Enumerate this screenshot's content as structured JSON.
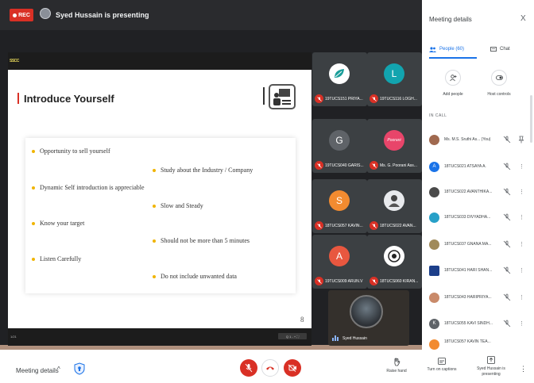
{
  "top_bar": {
    "rec_label": "REC",
    "presenting_text": "Syed Hussain is presenting"
  },
  "shared_screen": {
    "top_mark": "SSCC",
    "slide_title": "Introduce Yourself",
    "bullets": [
      "Opportunity to sell yourself",
      "Study about the Industry / Company",
      "Dynamic Self introduction is appreciable",
      "Slow and Steady",
      "Know your target",
      "Should not be more than 5 minutes",
      "Listen Carefully",
      "Do not include unwanted data"
    ],
    "page_number": "8",
    "bottom_left": "1/21",
    "bottom_right": "Q 1 - + ⛶"
  },
  "tiles": [
    {
      "name": "19TUCS151 PRIYA...",
      "avatar": "",
      "color": "#ffffff",
      "icon": "logo-avatar"
    },
    {
      "name": "19TUCS116 LOGH...",
      "avatar": "L",
      "color": "#12a4af",
      "icon": "letter-avatar"
    },
    {
      "name": "19TUCS040 GARIS...",
      "avatar": "G",
      "color": "#5f6368",
      "icon": "letter-avatar"
    },
    {
      "name": "Ms. G. Poorani Ass...",
      "avatar": "Poorani",
      "color": "#e8456a",
      "icon": "photo-avatar"
    },
    {
      "name": "18TUCS057 KAVIN...",
      "avatar": "S",
      "color": "#f28b30",
      "icon": "letter-avatar"
    },
    {
      "name": "18TUCS022 AVAN...",
      "avatar": "",
      "color": "#e8eaed",
      "icon": "photo-avatar"
    },
    {
      "name": "19TUCS009 ARUN.V",
      "avatar": "A",
      "color": "#e8573f",
      "icon": "letter-avatar"
    },
    {
      "name": "18TUCS060 KIRAN...",
      "avatar": "",
      "color": "#ffffff",
      "icon": "photo-avatar"
    }
  ],
  "self_tile": {
    "name": "Syed Hussain"
  },
  "panel": {
    "title": "Meeting details",
    "close": "X",
    "tab_people": "People (60)",
    "tab_chat": "Chat",
    "add_people": "Add people",
    "host_controls": "Host controls",
    "in_call": "IN CALL",
    "people": [
      {
        "name": "Ms. M.S. Sruthi As... (You)",
        "avatar": "",
        "color": "#a0694f"
      },
      {
        "name": "18TUCS021 ATSAYA A.",
        "avatar": "A",
        "color": "#1a73e8"
      },
      {
        "name": "18TUCS022 AVANTHIKA...",
        "avatar": "",
        "color": "#4a4a4a"
      },
      {
        "name": "18TUCS033 DIVYADHA...",
        "avatar": "",
        "color": "#27a0c8"
      },
      {
        "name": "18TUCS037 GNANA MA...",
        "avatar": "",
        "color": "#a08a5a"
      },
      {
        "name": "18TUCS041 HARI SHAN...",
        "avatar": "",
        "color": "#1c3f8a"
      },
      {
        "name": "18TUCS043 HARIPRIYA...",
        "avatar": "",
        "color": "#c98a6a"
      },
      {
        "name": "18TUCS055 KAVI SINDH...",
        "avatar": "K",
        "color": "#5f6368"
      },
      {
        "name": "18TUCS057 KAVIN TEA...",
        "avatar": "",
        "color": "#f28b30"
      }
    ]
  },
  "bottom_bar": {
    "meeting_details": "Meeting details",
    "raise_hand": "Raise hand",
    "captions": "Turn on captions",
    "presenting": "Syed Hussain is presenting"
  }
}
